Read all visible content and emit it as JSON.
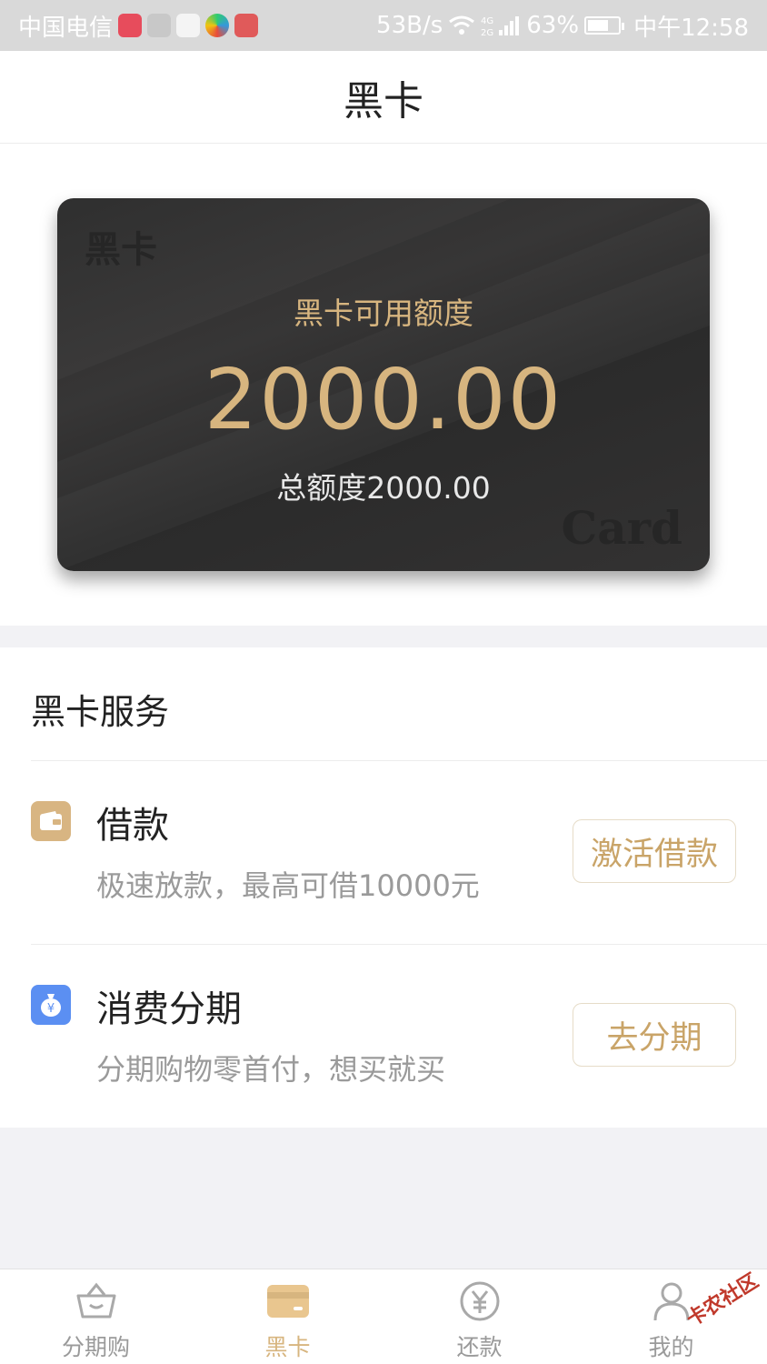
{
  "status_bar": {
    "carrier": "中国电信",
    "speed": "53B/s",
    "network": "4G 2G",
    "battery": "63%",
    "time": "中午12:58"
  },
  "header": {
    "title": "黑卡"
  },
  "card": {
    "watermark_top": "黑卡",
    "watermark_bottom": "Card",
    "available_label": "黑卡可用额度",
    "available_amount": "2000.00",
    "total_label": "总额度2000.00"
  },
  "services": {
    "title": "黑卡服务",
    "items": [
      {
        "title": "借款",
        "desc": "极速放款，最高可借10000元",
        "button": "激活借款",
        "icon": "wallet-icon",
        "color": "#d8b582"
      },
      {
        "title": "消费分期",
        "desc": "分期购物零首付，想买就买",
        "button": "去分期",
        "icon": "money-bag-icon",
        "color": "#5b8ff2"
      }
    ]
  },
  "bottom_nav": {
    "items": [
      {
        "label": "分期购",
        "icon": "basket-icon",
        "active": false
      },
      {
        "label": "黑卡",
        "icon": "card-icon",
        "active": true
      },
      {
        "label": "还款",
        "icon": "yuan-coin-icon",
        "active": false
      },
      {
        "label": "我的",
        "icon": "user-icon",
        "active": false
      }
    ]
  },
  "watermark": "卡农社区",
  "colors": {
    "gold": "#d7b57f",
    "card_bg": "#333232"
  }
}
